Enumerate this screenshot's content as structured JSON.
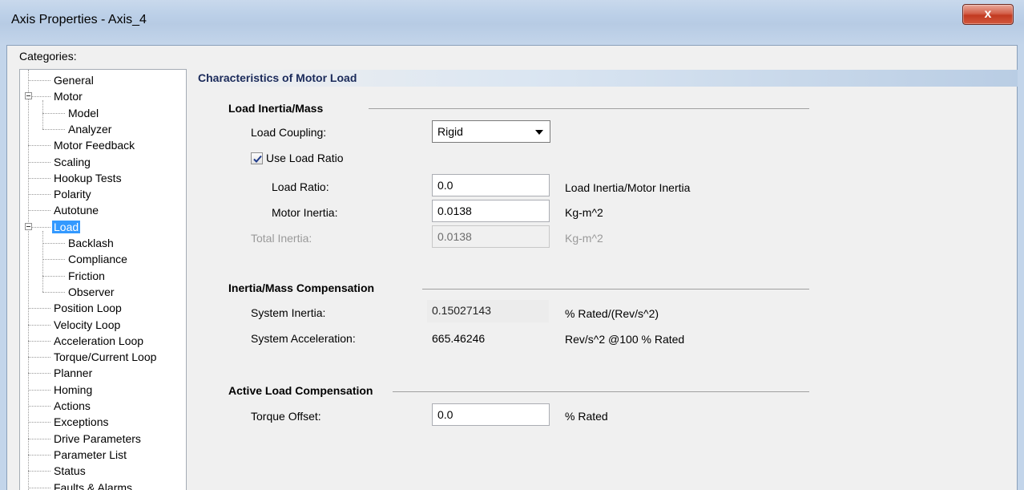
{
  "window": {
    "title": "Axis Properties - Axis_4",
    "close_glyph": "x"
  },
  "categories": {
    "label": "Categories:",
    "items": [
      {
        "label": "General",
        "level": 0
      },
      {
        "label": "Motor",
        "level": 0,
        "expanded": true
      },
      {
        "label": "Model",
        "level": 1
      },
      {
        "label": "Analyzer",
        "level": 1
      },
      {
        "label": "Motor Feedback",
        "level": 0
      },
      {
        "label": "Scaling",
        "level": 0
      },
      {
        "label": "Hookup Tests",
        "level": 0
      },
      {
        "label": "Polarity",
        "level": 0
      },
      {
        "label": "Autotune",
        "level": 0
      },
      {
        "label": "Load",
        "level": 0,
        "expanded": true,
        "selected": true
      },
      {
        "label": "Backlash",
        "level": 1
      },
      {
        "label": "Compliance",
        "level": 1
      },
      {
        "label": "Friction",
        "level": 1
      },
      {
        "label": "Observer",
        "level": 1
      },
      {
        "label": "Position Loop",
        "level": 0
      },
      {
        "label": "Velocity Loop",
        "level": 0
      },
      {
        "label": "Acceleration Loop",
        "level": 0
      },
      {
        "label": "Torque/Current Loop",
        "level": 0
      },
      {
        "label": "Planner",
        "level": 0
      },
      {
        "label": "Homing",
        "level": 0
      },
      {
        "label": "Actions",
        "level": 0
      },
      {
        "label": "Exceptions",
        "level": 0
      },
      {
        "label": "Drive Parameters",
        "level": 0
      },
      {
        "label": "Parameter List",
        "level": 0
      },
      {
        "label": "Status",
        "level": 0
      },
      {
        "label": "Faults & Alarms",
        "level": 0
      }
    ]
  },
  "panel": {
    "header": "Characteristics of Motor Load",
    "load_inertia": {
      "title": "Load Inertia/Mass",
      "coupling_label": "Load Coupling:",
      "coupling_value": "Rigid",
      "use_ratio_label": "Use Load Ratio",
      "use_ratio_checked": true,
      "ratio_label": "Load Ratio:",
      "ratio_value": "0.0",
      "ratio_unit": "Load Inertia/Motor Inertia",
      "motor_inertia_label": "Motor Inertia:",
      "motor_inertia_value": "0.0138",
      "motor_inertia_unit": "Kg-m^2",
      "total_inertia_label": "Total Inertia:",
      "total_inertia_value": "0.0138",
      "total_inertia_unit": "Kg-m^2"
    },
    "compensation": {
      "title": "Inertia/Mass Compensation",
      "system_inertia_label": "System Inertia:",
      "system_inertia_value": "0.15027143",
      "system_inertia_unit": "% Rated/(Rev/s^2)",
      "system_accel_label": "System Acceleration:",
      "system_accel_value": "665.46246",
      "system_accel_unit": "Rev/s^2 @100 % Rated"
    },
    "active_load": {
      "title": "Active Load Compensation",
      "torque_offset_label": "Torque Offset:",
      "torque_offset_value": "0.0",
      "torque_offset_unit": "% Rated"
    }
  }
}
